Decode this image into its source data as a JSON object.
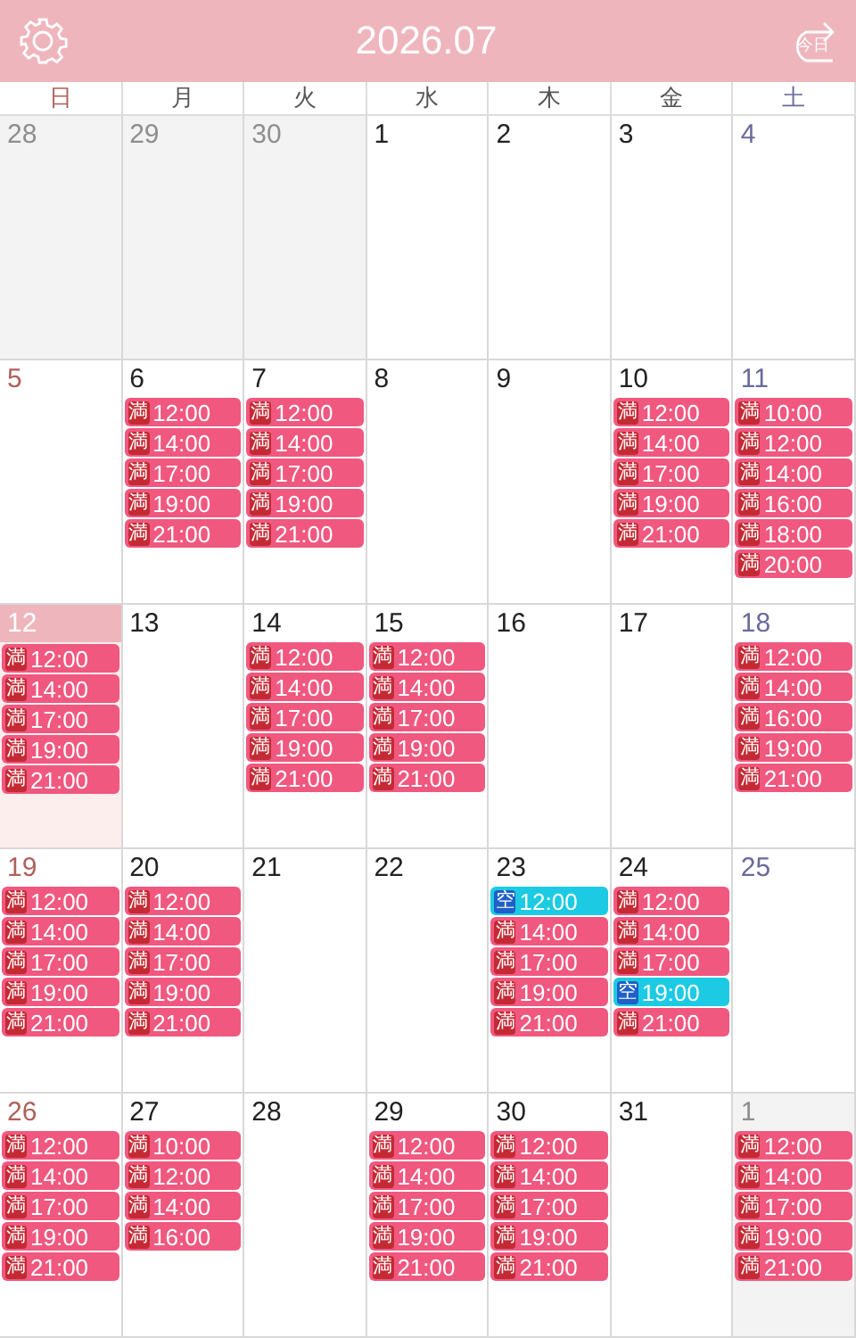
{
  "header": {
    "title": "2026.07",
    "today_label": "今日"
  },
  "weekdays": [
    "日",
    "月",
    "火",
    "水",
    "木",
    "金",
    "土"
  ],
  "weeks": [
    [
      {
        "day": "28",
        "outside": true,
        "selected": false
      },
      {
        "day": "29",
        "outside": true,
        "selected": false
      },
      {
        "day": "30",
        "outside": true,
        "selected": false
      },
      {
        "day": "1",
        "outside": false,
        "selected": false
      },
      {
        "day": "2",
        "outside": false,
        "selected": false
      },
      {
        "day": "3",
        "outside": false,
        "selected": false
      },
      {
        "day": "4",
        "outside": false,
        "selected": false
      }
    ],
    [
      {
        "day": "5",
        "outside": false,
        "selected": false
      },
      {
        "day": "6",
        "outside": false,
        "selected": false,
        "events": [
          {
            "kind": "full",
            "badge": "満",
            "time": "12:00"
          },
          {
            "kind": "full",
            "badge": "満",
            "time": "14:00"
          },
          {
            "kind": "full",
            "badge": "満",
            "time": "17:00"
          },
          {
            "kind": "full",
            "badge": "満",
            "time": "19:00"
          },
          {
            "kind": "full",
            "badge": "満",
            "time": "21:00"
          }
        ]
      },
      {
        "day": "7",
        "outside": false,
        "selected": false,
        "events": [
          {
            "kind": "full",
            "badge": "満",
            "time": "12:00"
          },
          {
            "kind": "full",
            "badge": "満",
            "time": "14:00"
          },
          {
            "kind": "full",
            "badge": "満",
            "time": "17:00"
          },
          {
            "kind": "full",
            "badge": "満",
            "time": "19:00"
          },
          {
            "kind": "full",
            "badge": "満",
            "time": "21:00"
          }
        ]
      },
      {
        "day": "8",
        "outside": false,
        "selected": false
      },
      {
        "day": "9",
        "outside": false,
        "selected": false
      },
      {
        "day": "10",
        "outside": false,
        "selected": false,
        "events": [
          {
            "kind": "full",
            "badge": "満",
            "time": "12:00"
          },
          {
            "kind": "full",
            "badge": "満",
            "time": "14:00"
          },
          {
            "kind": "full",
            "badge": "満",
            "time": "17:00"
          },
          {
            "kind": "full",
            "badge": "満",
            "time": "19:00"
          },
          {
            "kind": "full",
            "badge": "満",
            "time": "21:00"
          }
        ]
      },
      {
        "day": "11",
        "outside": false,
        "selected": false,
        "events": [
          {
            "kind": "full",
            "badge": "満",
            "time": "10:00"
          },
          {
            "kind": "full",
            "badge": "満",
            "time": "12:00"
          },
          {
            "kind": "full",
            "badge": "満",
            "time": "14:00"
          },
          {
            "kind": "full",
            "badge": "満",
            "time": "16:00"
          },
          {
            "kind": "full",
            "badge": "満",
            "time": "18:00"
          },
          {
            "kind": "full",
            "badge": "満",
            "time": "20:00"
          }
        ]
      }
    ],
    [
      {
        "day": "12",
        "outside": false,
        "selected": true,
        "events": [
          {
            "kind": "full",
            "badge": "満",
            "time": "12:00"
          },
          {
            "kind": "full",
            "badge": "満",
            "time": "14:00"
          },
          {
            "kind": "full",
            "badge": "満",
            "time": "17:00"
          },
          {
            "kind": "full",
            "badge": "満",
            "time": "19:00"
          },
          {
            "kind": "full",
            "badge": "満",
            "time": "21:00"
          }
        ]
      },
      {
        "day": "13",
        "outside": false,
        "selected": false
      },
      {
        "day": "14",
        "outside": false,
        "selected": false,
        "events": [
          {
            "kind": "full",
            "badge": "満",
            "time": "12:00"
          },
          {
            "kind": "full",
            "badge": "満",
            "time": "14:00"
          },
          {
            "kind": "full",
            "badge": "満",
            "time": "17:00"
          },
          {
            "kind": "full",
            "badge": "満",
            "time": "19:00"
          },
          {
            "kind": "full",
            "badge": "満",
            "time": "21:00"
          }
        ]
      },
      {
        "day": "15",
        "outside": false,
        "selected": false,
        "events": [
          {
            "kind": "full",
            "badge": "満",
            "time": "12:00"
          },
          {
            "kind": "full",
            "badge": "満",
            "time": "14:00"
          },
          {
            "kind": "full",
            "badge": "満",
            "time": "17:00"
          },
          {
            "kind": "full",
            "badge": "満",
            "time": "19:00"
          },
          {
            "kind": "full",
            "badge": "満",
            "time": "21:00"
          }
        ]
      },
      {
        "day": "16",
        "outside": false,
        "selected": false
      },
      {
        "day": "17",
        "outside": false,
        "selected": false
      },
      {
        "day": "18",
        "outside": false,
        "selected": false,
        "events": [
          {
            "kind": "full",
            "badge": "満",
            "time": "12:00"
          },
          {
            "kind": "full",
            "badge": "満",
            "time": "14:00"
          },
          {
            "kind": "full",
            "badge": "満",
            "time": "16:00"
          },
          {
            "kind": "full",
            "badge": "満",
            "time": "19:00"
          },
          {
            "kind": "full",
            "badge": "満",
            "time": "21:00"
          }
        ]
      }
    ],
    [
      {
        "day": "19",
        "outside": false,
        "selected": false,
        "events": [
          {
            "kind": "full",
            "badge": "満",
            "time": "12:00"
          },
          {
            "kind": "full",
            "badge": "満",
            "time": "14:00"
          },
          {
            "kind": "full",
            "badge": "満",
            "time": "17:00"
          },
          {
            "kind": "full",
            "badge": "満",
            "time": "19:00"
          },
          {
            "kind": "full",
            "badge": "満",
            "time": "21:00"
          }
        ]
      },
      {
        "day": "20",
        "outside": false,
        "selected": false,
        "events": [
          {
            "kind": "full",
            "badge": "満",
            "time": "12:00"
          },
          {
            "kind": "full",
            "badge": "満",
            "time": "14:00"
          },
          {
            "kind": "full",
            "badge": "満",
            "time": "17:00"
          },
          {
            "kind": "full",
            "badge": "満",
            "time": "19:00"
          },
          {
            "kind": "full",
            "badge": "満",
            "time": "21:00"
          }
        ]
      },
      {
        "day": "21",
        "outside": false,
        "selected": false
      },
      {
        "day": "22",
        "outside": false,
        "selected": false
      },
      {
        "day": "23",
        "outside": false,
        "selected": false,
        "events": [
          {
            "kind": "free",
            "badge": "空",
            "time": "12:00"
          },
          {
            "kind": "full",
            "badge": "満",
            "time": "14:00"
          },
          {
            "kind": "full",
            "badge": "満",
            "time": "17:00"
          },
          {
            "kind": "full",
            "badge": "満",
            "time": "19:00"
          },
          {
            "kind": "full",
            "badge": "満",
            "time": "21:00"
          }
        ]
      },
      {
        "day": "24",
        "outside": false,
        "selected": false,
        "events": [
          {
            "kind": "full",
            "badge": "満",
            "time": "12:00"
          },
          {
            "kind": "full",
            "badge": "満",
            "time": "14:00"
          },
          {
            "kind": "full",
            "badge": "満",
            "time": "17:00"
          },
          {
            "kind": "free",
            "badge": "空",
            "time": "19:00"
          },
          {
            "kind": "full",
            "badge": "満",
            "time": "21:00"
          }
        ]
      },
      {
        "day": "25",
        "outside": false,
        "selected": false
      }
    ],
    [
      {
        "day": "26",
        "outside": false,
        "selected": false,
        "events": [
          {
            "kind": "full",
            "badge": "満",
            "time": "12:00"
          },
          {
            "kind": "full",
            "badge": "満",
            "time": "14:00"
          },
          {
            "kind": "full",
            "badge": "満",
            "time": "17:00"
          },
          {
            "kind": "full",
            "badge": "満",
            "time": "19:00"
          },
          {
            "kind": "full",
            "badge": "満",
            "time": "21:00"
          }
        ]
      },
      {
        "day": "27",
        "outside": false,
        "selected": false,
        "events": [
          {
            "kind": "full",
            "badge": "満",
            "time": "10:00"
          },
          {
            "kind": "full",
            "badge": "満",
            "time": "12:00"
          },
          {
            "kind": "full",
            "badge": "満",
            "time": "14:00"
          },
          {
            "kind": "full",
            "badge": "満",
            "time": "16:00"
          }
        ]
      },
      {
        "day": "28",
        "outside": false,
        "selected": false
      },
      {
        "day": "29",
        "outside": false,
        "selected": false,
        "events": [
          {
            "kind": "full",
            "badge": "満",
            "time": "12:00"
          },
          {
            "kind": "full",
            "badge": "満",
            "time": "14:00"
          },
          {
            "kind": "full",
            "badge": "満",
            "time": "17:00"
          },
          {
            "kind": "full",
            "badge": "満",
            "time": "19:00"
          },
          {
            "kind": "full",
            "badge": "満",
            "time": "21:00"
          }
        ]
      },
      {
        "day": "30",
        "outside": false,
        "selected": false,
        "events": [
          {
            "kind": "full",
            "badge": "満",
            "time": "12:00"
          },
          {
            "kind": "full",
            "badge": "満",
            "time": "14:00"
          },
          {
            "kind": "full",
            "badge": "満",
            "time": "17:00"
          },
          {
            "kind": "full",
            "badge": "満",
            "time": "19:00"
          },
          {
            "kind": "full",
            "badge": "満",
            "time": "21:00"
          }
        ]
      },
      {
        "day": "31",
        "outside": false,
        "selected": false
      },
      {
        "day": "1",
        "outside": true,
        "selected": false,
        "events": [
          {
            "kind": "full",
            "badge": "満",
            "time": "12:00"
          },
          {
            "kind": "full",
            "badge": "満",
            "time": "14:00"
          },
          {
            "kind": "full",
            "badge": "満",
            "time": "17:00"
          },
          {
            "kind": "full",
            "badge": "満",
            "time": "19:00"
          },
          {
            "kind": "full",
            "badge": "満",
            "time": "21:00"
          }
        ]
      }
    ]
  ]
}
